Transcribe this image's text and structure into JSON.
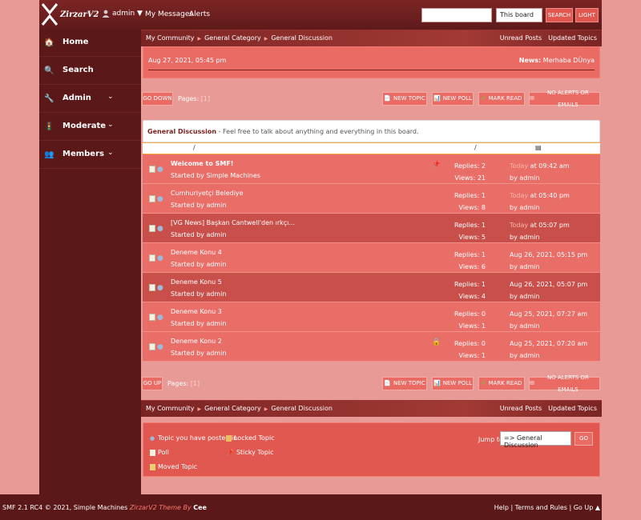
{
  "header": {
    "brand": "ZirzarV2",
    "user": "admin ▼",
    "nav": [
      "My Messages",
      "Alerts"
    ],
    "search_placeholder": "",
    "search_scope": "This board",
    "search_button": "SEARCH",
    "theme_button": "LIGHT"
  },
  "sidebar": {
    "items": [
      {
        "label": "Home",
        "icon": "home-icon"
      },
      {
        "label": "Search",
        "icon": "search-icon"
      },
      {
        "label": "Admin",
        "icon": "tools-icon",
        "chevron": "⌄"
      },
      {
        "label": "Moderate",
        "icon": "traffic-light-icon",
        "chevron": "⌄"
      },
      {
        "label": "Members",
        "icon": "members-icon",
        "chevron": "⌄"
      }
    ]
  },
  "breadcrumb": {
    "items": [
      "My Community",
      "General Category",
      "General Discussion"
    ],
    "links": [
      "Unread Posts",
      "Updated Topics"
    ]
  },
  "newsbar": {
    "date": "Aug 27, 2021, 05:45 pm",
    "news_label": "News:",
    "news_text": "Merhaba DÜnya"
  },
  "pager_top": {
    "nav_button": "GO DOWN",
    "pages_label": "Pages:",
    "pages_value": "[1]",
    "actions": [
      "NEW TOPIC",
      "NEW POLL",
      "MARK READ",
      "NO ALERTS OR EMAILS"
    ]
  },
  "board": {
    "title": "General Discussion",
    "description": " - Feel free to talk about anything and everything in this board.",
    "col_subject": "/",
    "col_stats": "/"
  },
  "topics": [
    {
      "title": "Welcome to SMF!",
      "started_by": "Started by ",
      "author": "Simple Machines",
      "replies": "Replies: 2",
      "views": "Views: 21",
      "last_prefix": "Today",
      "last_time": " at 09:42 am",
      "last_by": "by ",
      "last_author": "admin",
      "bold": true,
      "flag": "📌"
    },
    {
      "title": "Cumhuriyetçi Belediye",
      "started_by": "Started by ",
      "author": "admin",
      "replies": "Replies: 1",
      "views": "Views: 8",
      "last_prefix": "Today",
      "last_time": " at 05:40 pm",
      "last_by": "by ",
      "last_author": "admin",
      "bold": false,
      "flag": ""
    },
    {
      "title": "[VG News] Başkan Cantwell'den ırkçı...",
      "started_by": "Started by ",
      "author": "admin",
      "replies": "Replies: 1",
      "views": "Views: 5",
      "last_prefix": "Today",
      "last_time": " at 05:07 pm",
      "last_by": "by ",
      "last_author": "admin",
      "bold": false,
      "flag": ""
    },
    {
      "title": "Deneme Konu 4",
      "started_by": "Started by ",
      "author": "admin",
      "replies": "Replies: 1",
      "views": "Views: 6",
      "last_prefix": "",
      "last_time": "Aug 26, 2021, 05:15 pm",
      "last_by": "by ",
      "last_author": "admin",
      "bold": false,
      "flag": ""
    },
    {
      "title": "Deneme Konu 5",
      "started_by": "Started by ",
      "author": "admin",
      "replies": "Replies: 1",
      "views": "Views: 4",
      "last_prefix": "",
      "last_time": "Aug 26, 2021, 05:07 pm",
      "last_by": "by ",
      "last_author": "admin",
      "bold": false,
      "flag": ""
    },
    {
      "title": "Deneme Konu 3",
      "started_by": "Started by ",
      "author": "admin",
      "replies": "Replies: 0",
      "views": "Views: 1",
      "last_prefix": "",
      "last_time": "Aug 25, 2021, 07:27 am",
      "last_by": "by ",
      "last_author": "admin",
      "bold": false,
      "flag": ""
    },
    {
      "title": "Deneme Konu 2",
      "started_by": "Started by ",
      "author": "admin",
      "replies": "Replies: 0",
      "views": "Views: 1",
      "last_prefix": "",
      "last_time": "Aug 25, 2021, 07:20 am",
      "last_by": "by ",
      "last_author": "admin",
      "bold": false,
      "flag": "🔒"
    }
  ],
  "pager_bottom": {
    "nav_button": "GO UP",
    "pages_label": "Pages:",
    "pages_value": "[1]",
    "actions": [
      "NEW TOPIC",
      "NEW POLL",
      "MARK READ",
      "NO ALERTS OR EMAILS"
    ]
  },
  "legend": {
    "items": [
      "Topic you have posted in",
      "Poll",
      "Moved Topic",
      "Locked Topic",
      "Sticky Topic"
    ],
    "jump_label": "Jump to:",
    "jump_value": "=> General Discussion",
    "jump_button": "GO"
  },
  "footer": {
    "copyright": "SMF 2.1 RC4 © 2021, Simple Machines ",
    "theme": "ZirzarV2 Theme By ",
    "author": "Cee",
    "links": "Help | Terms and Rules | Go Up ▲"
  },
  "colors": {
    "background": "#e79a96",
    "sidebar": "#5a1818",
    "accent": "#e96b64",
    "row_alt": "#c9504a"
  }
}
